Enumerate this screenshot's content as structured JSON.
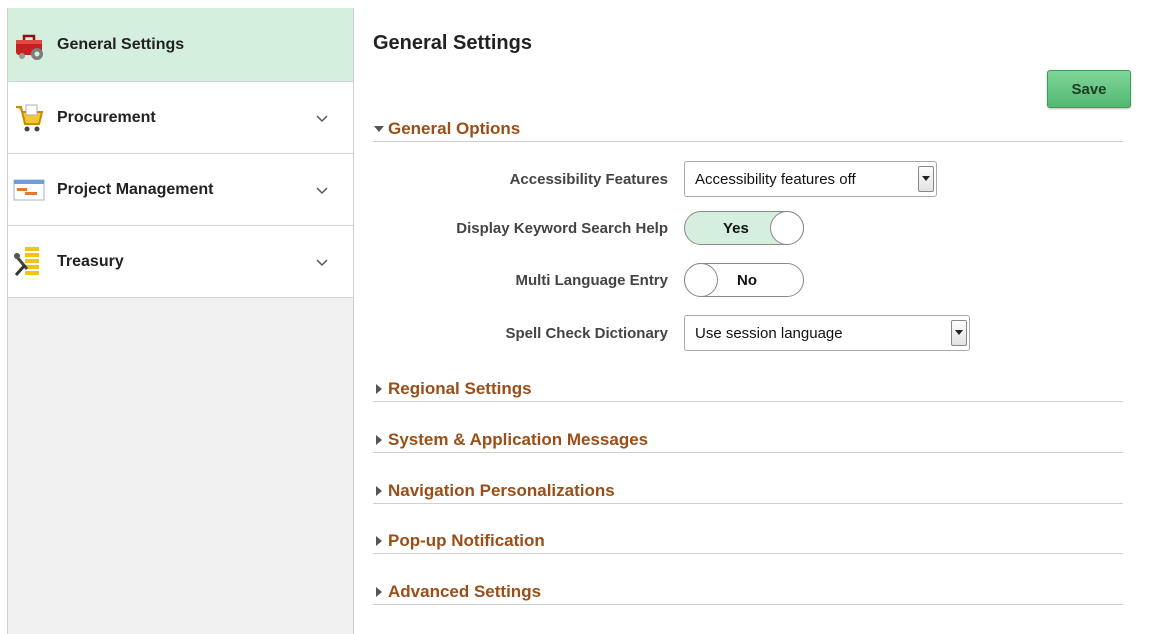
{
  "sidebar": {
    "items": [
      {
        "label": "General Settings",
        "icon": "toolbox-icon",
        "active": true
      },
      {
        "label": "Procurement",
        "icon": "shopping-cart-icon"
      },
      {
        "label": "Project Management",
        "icon": "gantt-chart-icon"
      },
      {
        "label": "Treasury",
        "icon": "treasury-icon"
      }
    ]
  },
  "main": {
    "title": "General Settings",
    "save_label": "Save",
    "general_options": {
      "title": "General Options",
      "fields": {
        "accessibility": {
          "label": "Accessibility Features",
          "value": "Accessibility features off"
        },
        "keyword_help": {
          "label": "Display Keyword Search Help",
          "value": "Yes"
        },
        "multi_language": {
          "label": "Multi Language Entry",
          "value": "No"
        },
        "spell_check": {
          "label": "Spell Check Dictionary",
          "value": "Use session language"
        }
      }
    },
    "sections": [
      "Regional Settings",
      "System & Application Messages",
      "Navigation Personalizations",
      "Pop-up Notification",
      "Advanced Settings"
    ]
  },
  "colors": {
    "active_bg": "#d5efdf",
    "section_title": "#9a4e18",
    "save_button": "#52b970"
  }
}
